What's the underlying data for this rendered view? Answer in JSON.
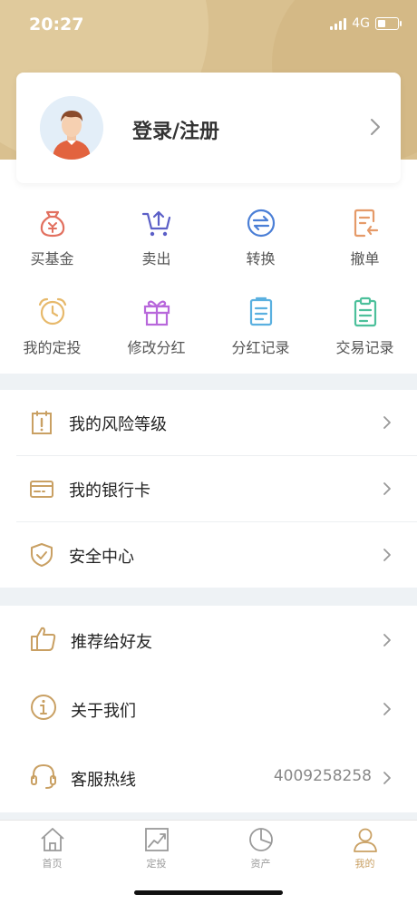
{
  "status_bar": {
    "time": "20:27",
    "network": "4G"
  },
  "profile": {
    "login_label": "登录/注册"
  },
  "quick_actions": [
    {
      "label": "买基金",
      "icon": "money-bag-icon",
      "color": "#e2705f"
    },
    {
      "label": "卖出",
      "icon": "cart-upload-icon",
      "color": "#5b5fc7"
    },
    {
      "label": "转换",
      "icon": "swap-icon",
      "color": "#4b7fd6"
    },
    {
      "label": "撤单",
      "icon": "cancel-order-icon",
      "color": "#e59a68"
    },
    {
      "label": "我的定投",
      "icon": "alarm-clock-icon",
      "color": "#e7b96b"
    },
    {
      "label": "修改分红",
      "icon": "gift-icon",
      "color": "#b868db"
    },
    {
      "label": "分红记录",
      "icon": "document-icon",
      "color": "#5ab0e0"
    },
    {
      "label": "交易记录",
      "icon": "clipboard-icon",
      "color": "#4cc09b"
    }
  ],
  "menu_section_1": [
    {
      "label": "我的风险等级",
      "icon": "risk-level-icon"
    },
    {
      "label": "我的银行卡",
      "icon": "bank-card-icon"
    },
    {
      "label": "安全中心",
      "icon": "shield-check-icon"
    }
  ],
  "menu_section_2": [
    {
      "label": "推荐给好友",
      "icon": "thumbs-up-icon"
    },
    {
      "label": "关于我们",
      "icon": "info-icon"
    },
    {
      "label": "客服热线",
      "icon": "headset-icon",
      "value": "4009258258"
    }
  ],
  "tabbar": {
    "active": "我的",
    "items": [
      {
        "label": "首页",
        "icon": "home-icon"
      },
      {
        "label": "定投",
        "icon": "chart-trend-icon"
      },
      {
        "label": "资产",
        "icon": "pie-chart-icon"
      },
      {
        "label": "我的",
        "icon": "user-icon"
      }
    ]
  },
  "colors": {
    "gold": "#c9a063",
    "header": "#d9c08f",
    "text": "#222222",
    "muted": "#9a9a9a"
  }
}
